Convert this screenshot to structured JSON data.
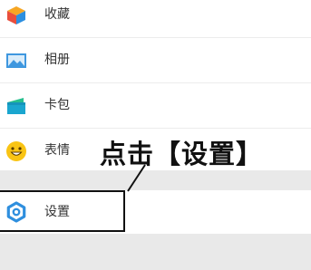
{
  "menu": {
    "items": [
      {
        "label": "收藏",
        "icon": "cube-icon"
      },
      {
        "label": "相册",
        "icon": "picture-icon"
      },
      {
        "label": "卡包",
        "icon": "wallet-icon"
      },
      {
        "label": "表情",
        "icon": "smiley-icon"
      }
    ],
    "settings": {
      "label": "设置",
      "icon": "gear-icon"
    }
  },
  "annotation": {
    "text": "点击【设置】"
  },
  "colors": {
    "background": "#ffffff",
    "section_gap": "#e9e9e9",
    "settings_icon": "#2f8fde",
    "album_icon": "#3e97df",
    "wallet_icon": "#1aa6cf",
    "smiley_icon": "#f9c414",
    "annotation": "#111111"
  }
}
